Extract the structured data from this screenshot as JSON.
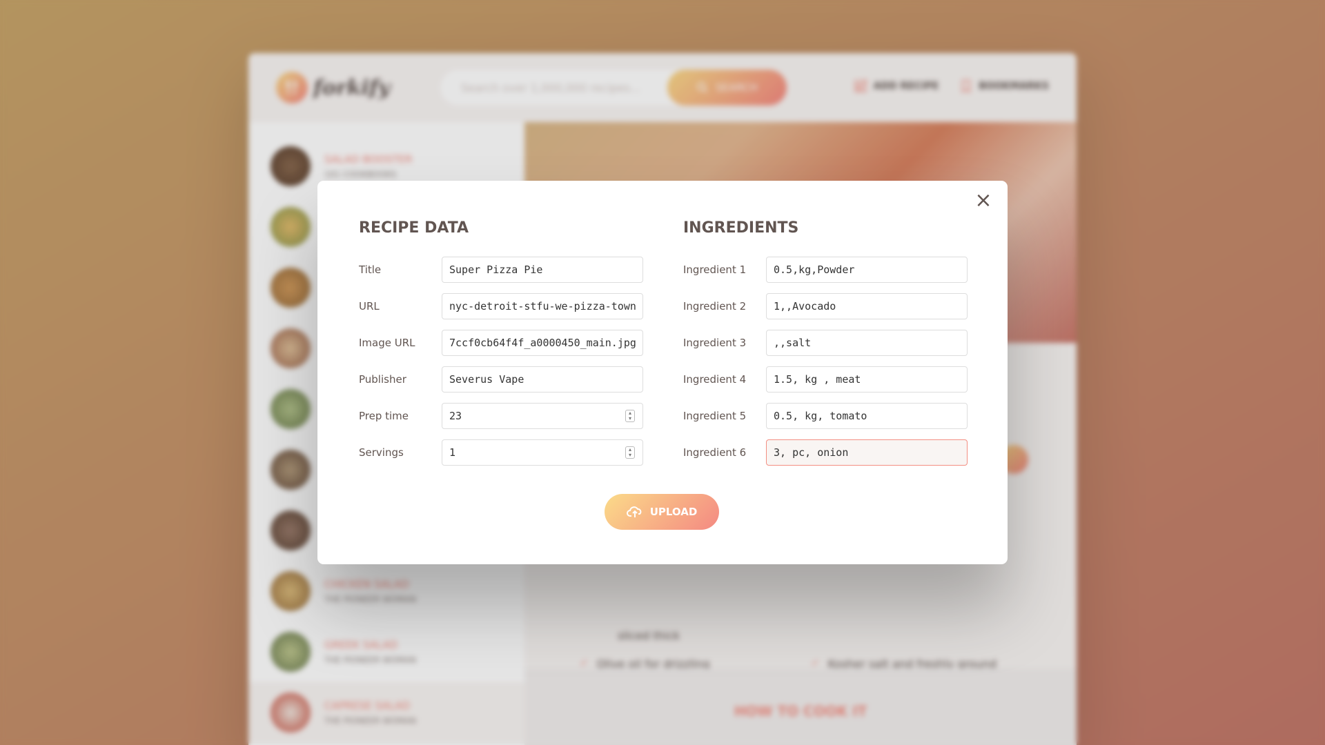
{
  "header": {
    "logo_text": "forkify",
    "search": {
      "placeholder": "Search over 1,000,000 recipes...",
      "button_label": "SEARCH"
    },
    "nav": {
      "add_recipe": "ADD RECIPE",
      "bookmarks": "BOOKMARKS"
    }
  },
  "sidebar": {
    "results": [
      {
        "title": "SALAD BOOSTER",
        "publisher": "101 COOKBOOKS",
        "color": "#6b5040"
      },
      {
        "title": "",
        "publisher": "",
        "color": "#a8b070"
      },
      {
        "title": "",
        "publisher": "",
        "color": "#b88850"
      },
      {
        "title": "",
        "publisher": "",
        "color": "#b89070"
      },
      {
        "title": "",
        "publisher": "",
        "color": "#90a060"
      },
      {
        "title": "",
        "publisher": "",
        "color": "#8a7050"
      },
      {
        "title": "",
        "publisher": "",
        "color": "#806050"
      },
      {
        "title": "CHICKEN SALAD",
        "publisher": "THE PIONEER WOMAN",
        "color": "#c8a060"
      },
      {
        "title": "GREEK SALAD",
        "publisher": "THE PIONEER WOMAN",
        "color": "#90a070"
      },
      {
        "title": "CAPRESE SALAD",
        "publisher": "THE PIONEER WOMAN",
        "color": "#c86050"
      }
    ]
  },
  "recipe": {
    "ingredients": [
      {
        "text": "sliced thick",
        "show_check": false
      },
      {
        "text": "Olive oil for drizzling",
        "show_check": true
      },
      {
        "text": "Kosher salt and freshly ground black pepper",
        "show_check": true
      }
    ],
    "how_to_cook_title": "HOW TO COOK IT"
  },
  "modal": {
    "recipe_heading": "RECIPE DATA",
    "ingredients_heading": "INGREDIENTS",
    "recipe_fields": [
      {
        "label": "Title",
        "value": "Super Pizza Pie",
        "type": "text"
      },
      {
        "label": "URL",
        "value": "nyc-detroit-stfu-we-pizza-town",
        "type": "text"
      },
      {
        "label": "Image URL",
        "value": "7ccf0cb64f4f_a0000450_main.jpg",
        "type": "text"
      },
      {
        "label": "Publisher",
        "value": "Severus Vape",
        "type": "text"
      },
      {
        "label": "Prep time",
        "value": "23",
        "type": "number"
      },
      {
        "label": "Servings",
        "value": "1",
        "type": "number"
      }
    ],
    "ingredient_fields": [
      {
        "label": "Ingredient 1",
        "value": "0.5,kg,Powder"
      },
      {
        "label": "Ingredient 2",
        "value": "1,,Avocado"
      },
      {
        "label": "Ingredient 3",
        "value": ",,salt"
      },
      {
        "label": "Ingredient 4",
        "value": "1.5, kg , meat"
      },
      {
        "label": "Ingredient 5",
        "value": "0.5, kg, tomato"
      },
      {
        "label": "Ingredient 6",
        "value": "3, pc, onion"
      }
    ],
    "upload_label": "UPLOAD",
    "close_glyph": "×"
  },
  "colors": {
    "accent": "#f38e82",
    "accent_light": "#fbdb89",
    "text": "#615551"
  }
}
